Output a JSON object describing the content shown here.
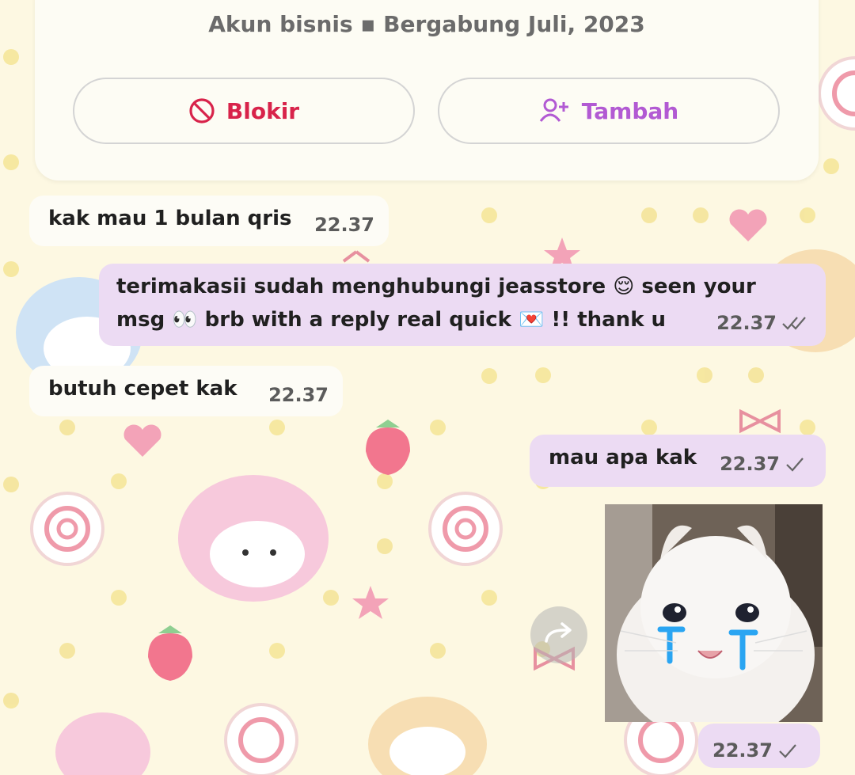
{
  "profile": {
    "subtitle": "Akun bisnis ▪ Bergabung Juli, 2023",
    "block_label": "Blokir",
    "add_label": "Tambah",
    "block_color": "#d8234a",
    "add_color": "#b25ad3"
  },
  "messages": [
    {
      "direction": "incoming",
      "text": "kak mau 1 bulan qris",
      "time": "22.37"
    },
    {
      "direction": "outgoing",
      "line1": "terimakasii sudah menghubungi jeasstore 😌 seen your",
      "line2": "msg 👀 brb with a reply real quick 💌 !! thank u",
      "time": "22.37",
      "status": "read"
    },
    {
      "direction": "incoming",
      "text": "butuh cepet kak",
      "time": "22.37"
    },
    {
      "direction": "outgoing",
      "text": "mau apa kak",
      "time": "22.37",
      "status": "sent"
    },
    {
      "direction": "outgoing",
      "type": "sticker",
      "sticker": "crying-cat-sticker",
      "time": "22.37",
      "status": "sent"
    }
  ],
  "icons": {
    "block": "block-icon",
    "add_person": "add-person-icon",
    "forward": "forward-icon",
    "check": "check-icon",
    "double_check": "double-check-icon"
  },
  "colors": {
    "outgoing_bubble": "#ecdbf3",
    "incoming_bubble": "#fdfcf6",
    "wallpaper": "#fdf8e2"
  }
}
